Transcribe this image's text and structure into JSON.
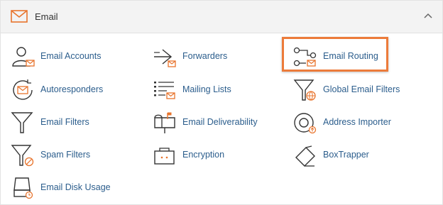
{
  "header": {
    "title": "Email",
    "icon": "envelope-icon",
    "toggle_icon": "chevron-up-icon"
  },
  "accent_color": "#e8742d",
  "link_color": "#2b5d8c",
  "items": [
    {
      "label": "Email Accounts",
      "icon": "email-accounts-icon"
    },
    {
      "label": "Forwarders",
      "icon": "forwarders-icon"
    },
    {
      "label": "Email Routing",
      "icon": "email-routing-icon",
      "highlighted": true
    },
    {
      "label": "Autoresponders",
      "icon": "autoresponders-icon"
    },
    {
      "label": "Mailing Lists",
      "icon": "mailing-lists-icon"
    },
    {
      "label": "Global Email Filters",
      "icon": "global-email-filters-icon"
    },
    {
      "label": "Email Filters",
      "icon": "email-filters-icon"
    },
    {
      "label": "Email Deliverability",
      "icon": "email-deliverability-icon"
    },
    {
      "label": "Address Importer",
      "icon": "address-importer-icon"
    },
    {
      "label": "Spam Filters",
      "icon": "spam-filters-icon"
    },
    {
      "label": "Encryption",
      "icon": "encryption-icon"
    },
    {
      "label": "BoxTrapper",
      "icon": "boxtrapper-icon"
    },
    {
      "label": "Email Disk Usage",
      "icon": "email-disk-usage-icon"
    }
  ]
}
